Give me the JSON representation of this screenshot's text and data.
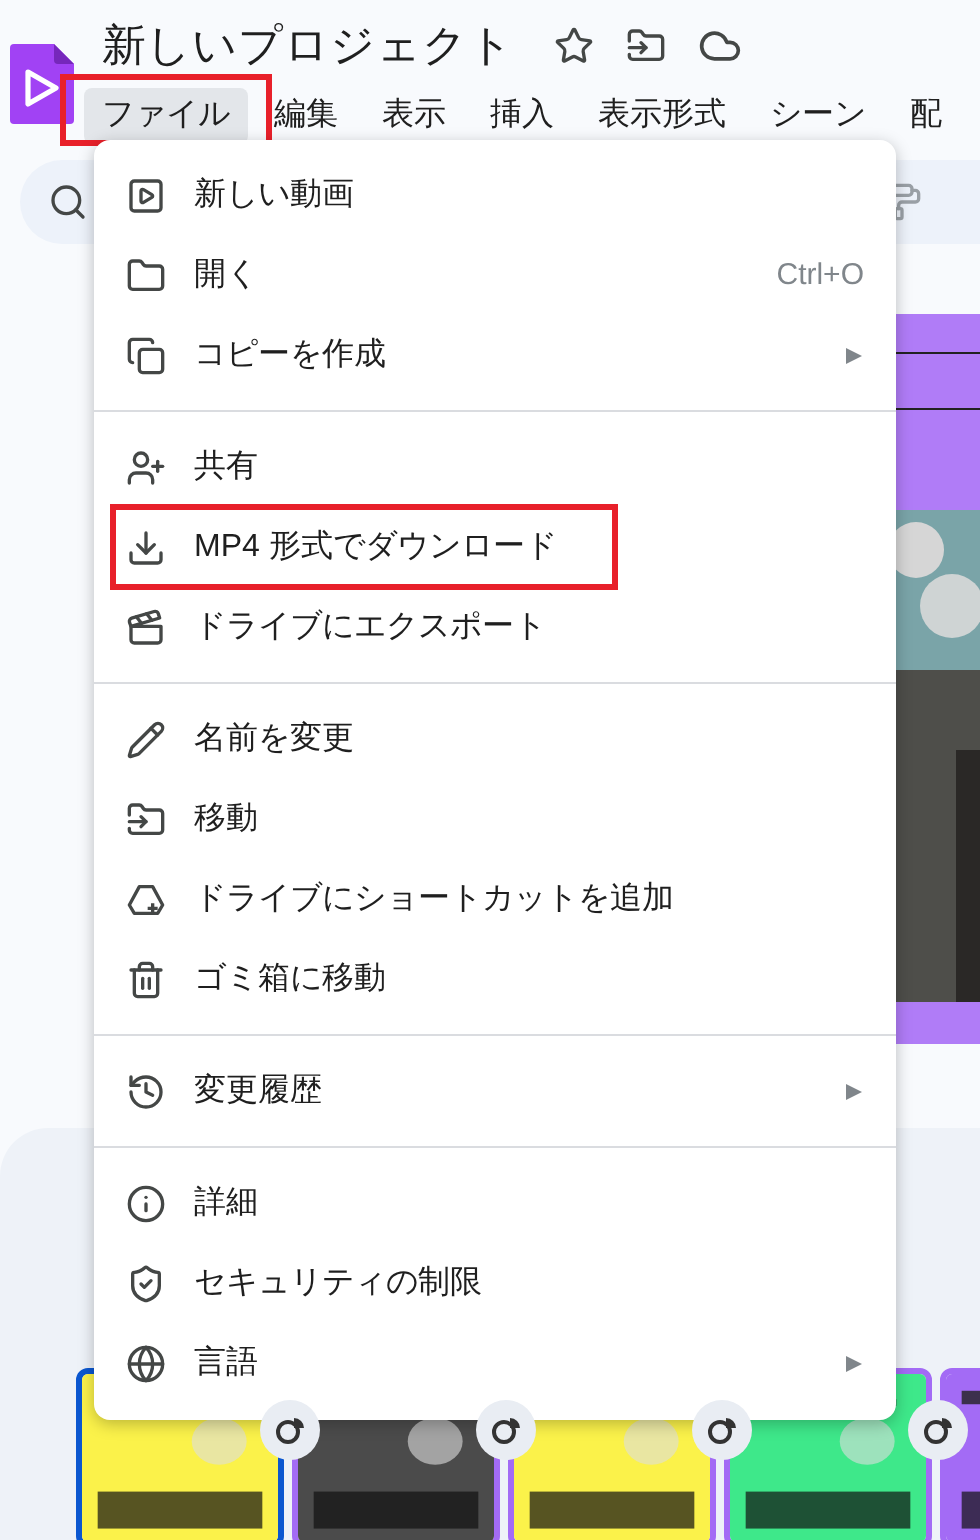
{
  "title": "新しいプロジェクト",
  "menubar": [
    {
      "label": "ファイル",
      "selected": true,
      "highlighted": true
    },
    {
      "label": "編集",
      "selected": false,
      "highlighted": false
    },
    {
      "label": "表示",
      "selected": false,
      "highlighted": false
    },
    {
      "label": "挿入",
      "selected": false,
      "highlighted": false
    },
    {
      "label": "表示形式",
      "selected": false,
      "highlighted": false
    },
    {
      "label": "シーン",
      "selected": false,
      "highlighted": false
    },
    {
      "label": "配",
      "selected": false,
      "highlighted": false
    }
  ],
  "file_menu": [
    [
      {
        "label": "新しい動画",
        "highlighted": false,
        "submenu": false
      },
      {
        "label": "開く",
        "shortcut": "Ctrl+O",
        "highlighted": false,
        "submenu": false
      },
      {
        "label": "コピーを作成",
        "highlighted": false,
        "submenu": true
      }
    ],
    [
      {
        "label": "共有",
        "highlighted": false,
        "submenu": false
      },
      {
        "label": "MP4 形式でダウンロード",
        "highlighted": true,
        "submenu": false
      },
      {
        "label": "ドライブにエクスポート",
        "highlighted": false,
        "submenu": false
      }
    ],
    [
      {
        "label": "名前を変更",
        "highlighted": false,
        "submenu": false
      },
      {
        "label": "移動",
        "highlighted": false,
        "submenu": false
      },
      {
        "label": "ドライブにショートカットを追加",
        "highlighted": false,
        "submenu": false
      },
      {
        "label": "ゴミ箱に移動",
        "highlighted": false,
        "submenu": false
      }
    ],
    [
      {
        "label": "変更履歴",
        "highlighted": false,
        "submenu": true
      }
    ],
    [
      {
        "label": "詳細",
        "highlighted": false,
        "submenu": false
      },
      {
        "label": "セキュリティの制限",
        "highlighted": false,
        "submenu": false
      },
      {
        "label": "言語",
        "highlighted": false,
        "submenu": true
      }
    ]
  ],
  "scenes": [
    {
      "selected": true
    },
    {
      "selected": false
    },
    {
      "selected": false
    },
    {
      "selected": false
    },
    {
      "selected": false
    }
  ]
}
